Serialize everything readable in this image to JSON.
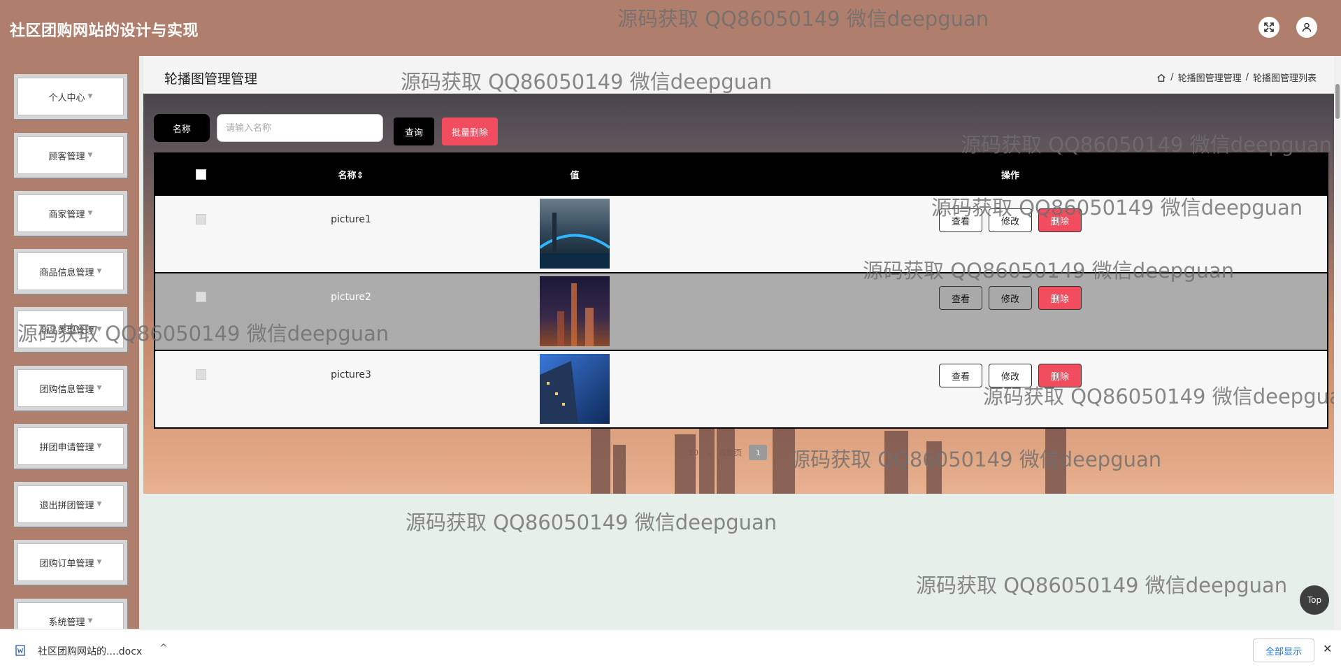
{
  "header": {
    "app_title": "社区团购网站的设计与实现",
    "fullscreen_icon": "fullscreen-icon",
    "avatar_icon": "user-avatar-icon"
  },
  "sidebar": {
    "items": [
      {
        "label": "个人中心"
      },
      {
        "label": "顾客管理"
      },
      {
        "label": "商家管理"
      },
      {
        "label": "商品信息管理"
      },
      {
        "label": "商品类型管理"
      },
      {
        "label": "团购信息管理"
      },
      {
        "label": "拼团申请管理"
      },
      {
        "label": "退出拼团管理"
      },
      {
        "label": "团购订单管理"
      },
      {
        "label": "系统管理"
      }
    ]
  },
  "page": {
    "title": "轮播图管理管理",
    "breadcrumb": [
      "轮播图管理管理",
      "轮播图管理列表"
    ],
    "breadcrumb_sep": "/"
  },
  "search": {
    "label": "名称",
    "placeholder": "请输入名称",
    "query_button": "查询",
    "batch_delete_button": "批量删除"
  },
  "table": {
    "headers": {
      "name": "名称",
      "value": "值",
      "ops": "操作"
    },
    "rows": [
      {
        "name": "picture1",
        "view": "查看",
        "edit": "修改",
        "delete": "删除"
      },
      {
        "name": "picture2",
        "view": "查看",
        "edit": "修改",
        "delete": "删除"
      },
      {
        "name": "picture3",
        "view": "查看",
        "edit": "修改",
        "delete": "删除"
      }
    ]
  },
  "pagination": {
    "page_size": "10",
    "jump_label": "去卸页",
    "current_page": "1"
  },
  "watermark": "源码获取 QQ86050149 微信deepguan",
  "top_button": "Top",
  "download_bar": {
    "file_name": "社区团购网站的....docx",
    "show_all": "全部显示",
    "close": "✕",
    "chevron": "^"
  },
  "colors": {
    "header_bg": "#b07e6c",
    "delete_red": "#f24d5e",
    "page_bg": "#e6efe9"
  }
}
